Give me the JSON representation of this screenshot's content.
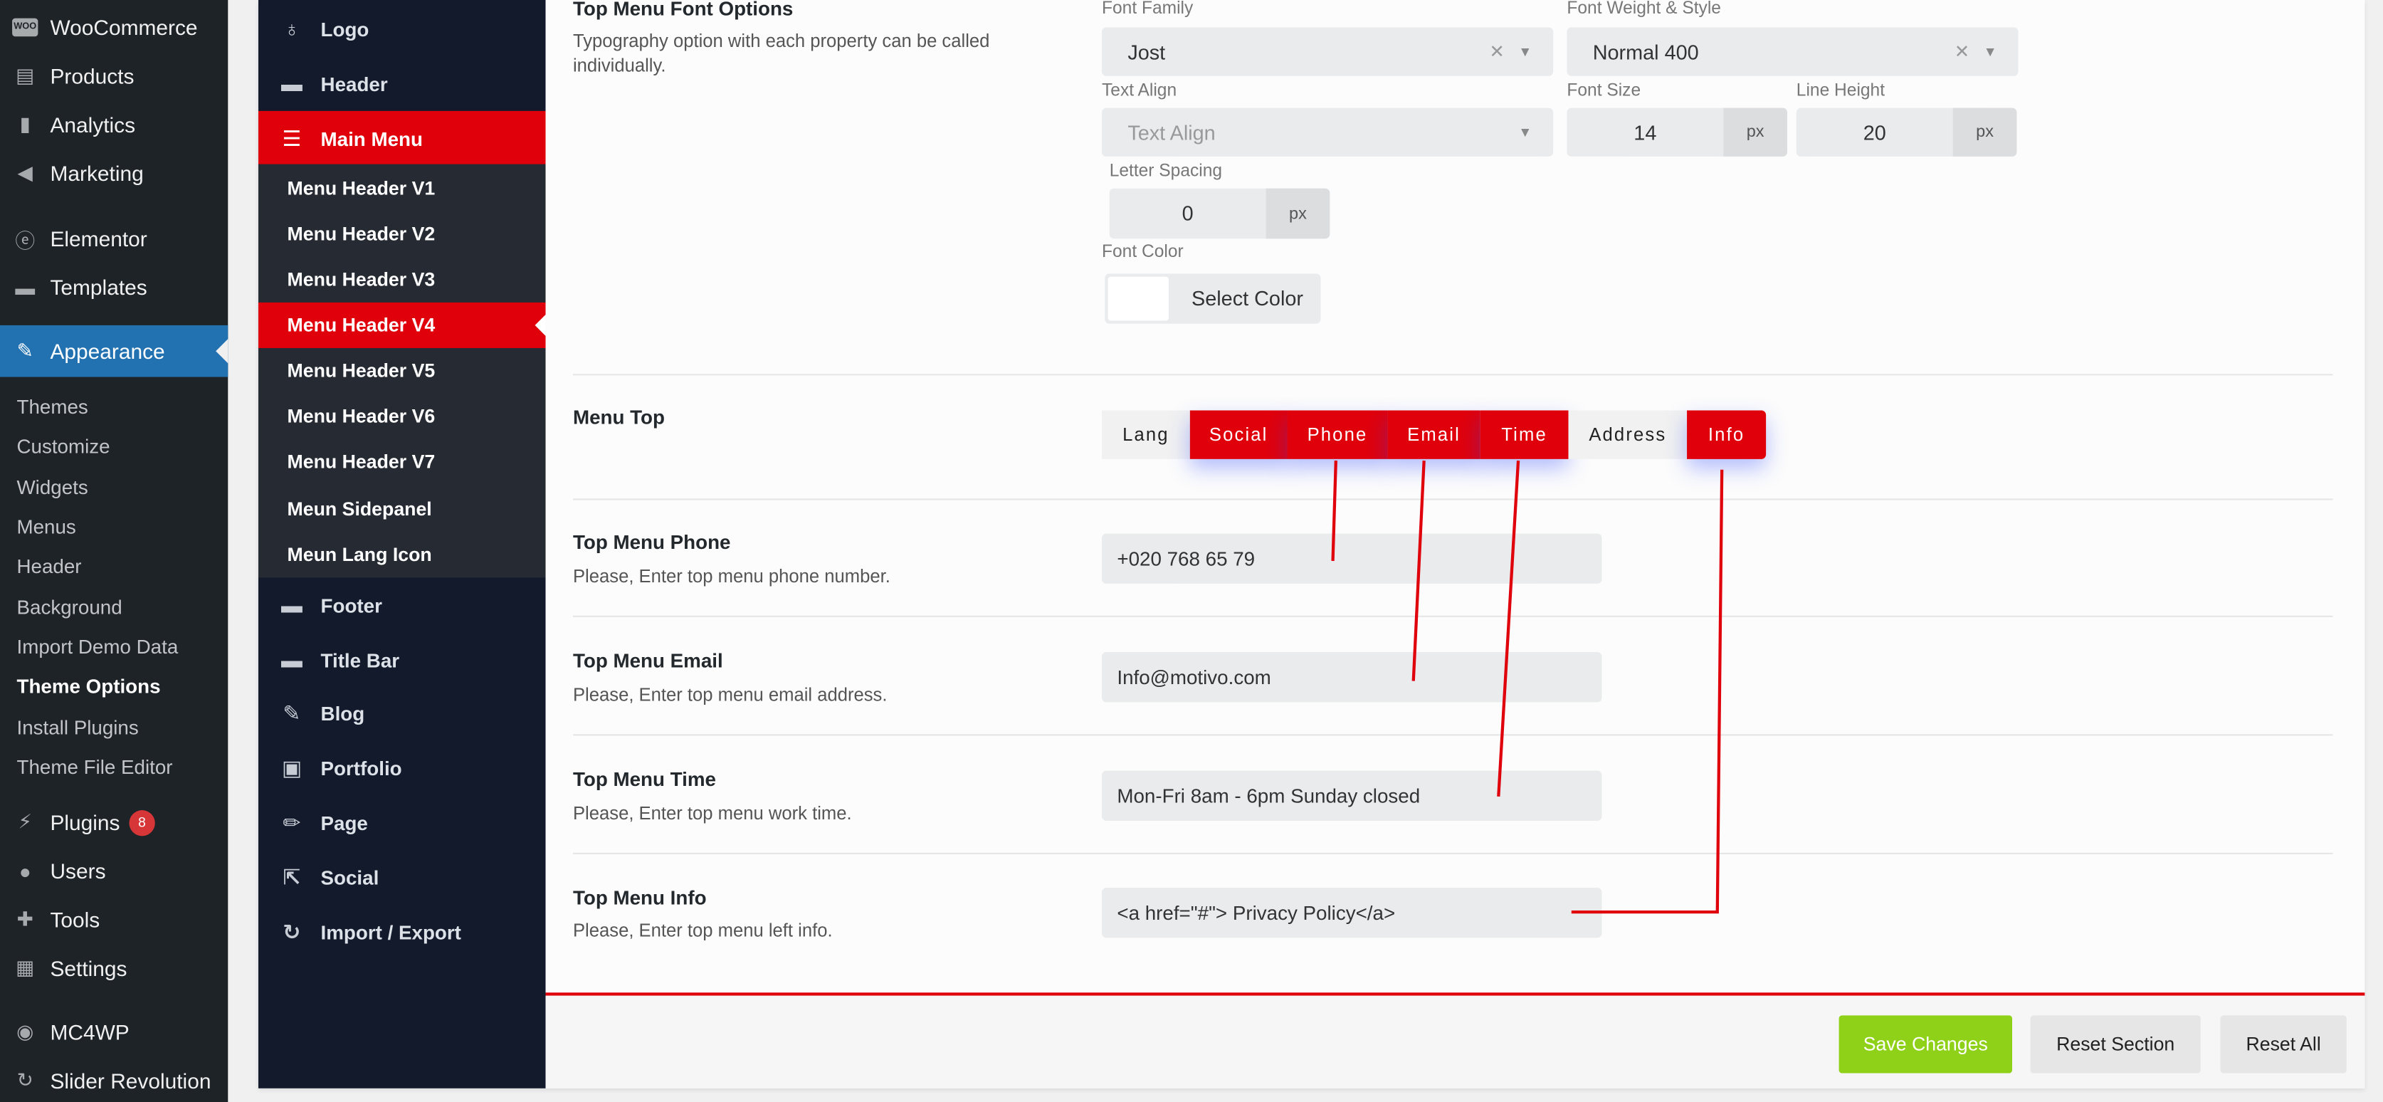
{
  "wp_menu": {
    "woocommerce": "WooCommerce",
    "woo_logo": "WOO",
    "products": "Products",
    "analytics": "Analytics",
    "marketing": "Marketing",
    "elementor": "Elementor",
    "templates": "Templates",
    "appearance": "Appearance",
    "appearance_sub": [
      "Themes",
      "Customize",
      "Widgets",
      "Menus",
      "Header",
      "Background",
      "Import Demo Data",
      "Theme Options",
      "Install Plugins",
      "Theme File Editor"
    ],
    "plugins": "Plugins",
    "plugins_badge": "8",
    "users": "Users",
    "tools": "Tools",
    "settings": "Settings",
    "mc4wp": "MC4WP",
    "slider_revolution": "Slider Revolution"
  },
  "options_menu": {
    "logo": "Logo",
    "header": "Header",
    "main_menu": "Main Menu",
    "main_menu_sub": [
      "Menu Header V1",
      "Menu Header V2",
      "Menu Header V3",
      "Menu Header V4",
      "Menu Header V5",
      "Menu Header V6",
      "Menu Header V7",
      "Meun Sidepanel",
      "Meun Lang Icon"
    ],
    "footer": "Footer",
    "title_bar": "Title Bar",
    "blog": "Blog",
    "portfolio": "Portfolio",
    "page": "Page",
    "social": "Social",
    "import_export": "Import / Export"
  },
  "font_options": {
    "title": "Top Menu Font Options",
    "desc": "Typography option with each property can be called individually.",
    "font_family_label": "Font Family",
    "font_family": "Jost",
    "font_weight_label": "Font Weight & Style",
    "font_weight": "Normal 400",
    "text_align_label": "Text Align",
    "text_align_placeholder": "Text Align",
    "font_size_label": "Font Size",
    "font_size": "14",
    "line_height_label": "Line Height",
    "line_height": "20",
    "letter_spacing_label": "Letter Spacing",
    "letter_spacing": "0",
    "unit": "px",
    "font_color_label": "Font Color",
    "select_color": "Select Color"
  },
  "menu_top": {
    "title": "Menu Top",
    "items": [
      "Lang",
      "Social",
      "Phone",
      "Email",
      "Time",
      "Address",
      "Info"
    ]
  },
  "phone": {
    "title": "Top Menu Phone",
    "desc": "Please, Enter top menu phone number.",
    "value": "+020 768 65 79"
  },
  "email": {
    "title": "Top Menu Email",
    "desc": "Please, Enter top menu email address.",
    "value": "Info@motivo.com"
  },
  "time": {
    "title": "Top Menu Time",
    "desc": "Please, Enter top menu work time.",
    "value": "Mon-Fri 8am - 6pm Sunday closed"
  },
  "info": {
    "title": "Top Menu Info",
    "desc": "Please, Enter top menu left info.",
    "value": "<a href=\"#\"> Privacy Policy</a>"
  },
  "footer_buttons": {
    "save": "Save Changes",
    "reset_section": "Reset Section",
    "reset_all": "Reset All"
  },
  "colors": {
    "accent": "#e0000b",
    "wp_active": "#2271b1",
    "save": "#8fd118",
    "annotation": "#e0000b"
  }
}
